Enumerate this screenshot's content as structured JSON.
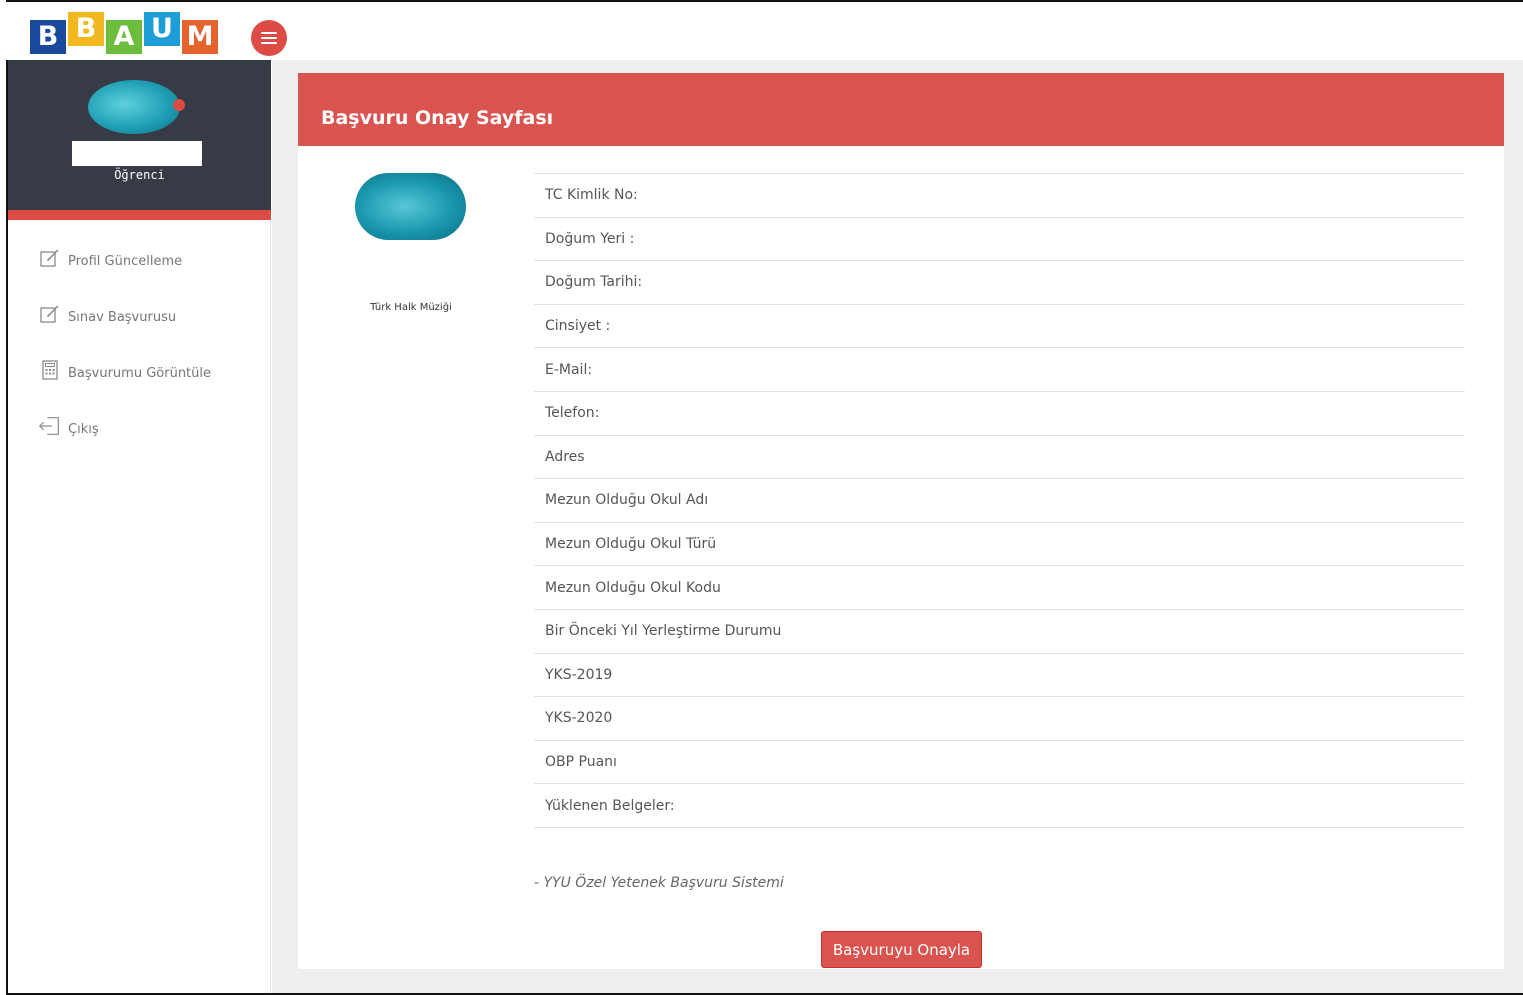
{
  "logo": {
    "letters": [
      {
        "char": "B",
        "color": "#1a4a9c"
      },
      {
        "char": "B",
        "color": "#f2b81f"
      },
      {
        "char": "A",
        "color": "#6dbd3d"
      },
      {
        "char": "U",
        "color": "#1e9ed6"
      },
      {
        "char": "M",
        "color": "#e5632c"
      }
    ]
  },
  "sidebar": {
    "role": "Öğrenci",
    "items": [
      {
        "label": "Profil Güncelleme",
        "icon": "edit-icon"
      },
      {
        "label": "Sınav Başvurusu",
        "icon": "edit-icon"
      },
      {
        "label": "Başvurumu Görüntüle",
        "icon": "calculator-icon"
      },
      {
        "label": "Çıkış",
        "icon": "sign-out-icon"
      }
    ]
  },
  "main": {
    "title": "Başvuru Onay Sayfası",
    "department": "Türk Halk Müziği",
    "fields": [
      "TC Kimlik No:",
      "Doğum Yeri :",
      "Doğum Tarihi:",
      "Cinsiyet :",
      "E-Mail:",
      "Telefon:",
      "Adres",
      "Mezun Olduğu Okul Adı",
      "Mezun Olduğu Okul Türü",
      "Mezun Olduğu Okul Kodu",
      "Bir Önceki Yıl Yerleştirme Durumu",
      "YKS-2019",
      "YKS-2020",
      "OBP Puanı",
      "Yüklenen Belgeler:"
    ],
    "footer_note": "- YYU Özel Yetenek Başvuru Sistemi",
    "confirm_button": "Başvuruyu Onayla"
  },
  "colors": {
    "accent": "#d9534f",
    "sidebar_dark": "#363b46"
  }
}
